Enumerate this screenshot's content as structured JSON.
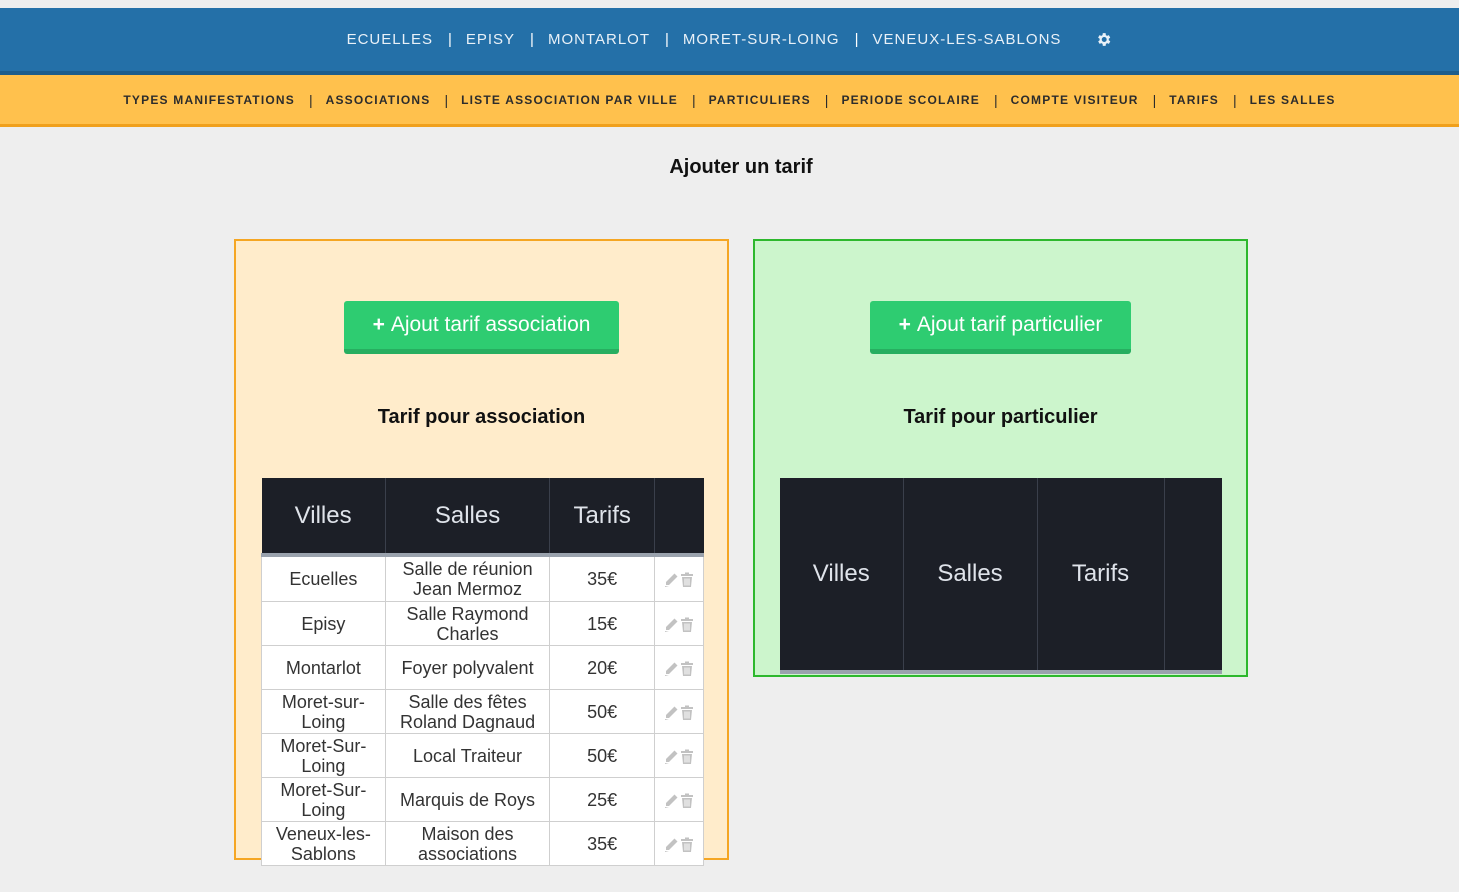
{
  "top_nav": {
    "items": [
      {
        "label": "ECUELLES"
      },
      {
        "label": "EPISY"
      },
      {
        "label": "MONTARLOT"
      },
      {
        "label": "MORET-SUR-LOING"
      },
      {
        "label": "VENEUX-LES-SABLONS"
      }
    ],
    "separator": "|",
    "settings_icon": "gear-icon"
  },
  "sub_nav": {
    "items": [
      {
        "label": "TYPES MANIFESTATIONS"
      },
      {
        "label": "ASSOCIATIONS"
      },
      {
        "label": "LISTE ASSOCIATION PAR VILLE"
      },
      {
        "label": "PARTICULIERS"
      },
      {
        "label": "PERIODE SCOLAIRE"
      },
      {
        "label": "COMPTE VISITEUR"
      },
      {
        "label": "TARIFS"
      },
      {
        "label": "LES SALLES"
      }
    ],
    "separator": "|"
  },
  "page": {
    "title": "Ajouter un tarif"
  },
  "association_panel": {
    "button_icon": "+",
    "button_label": "Ajout tarif association",
    "title": "Tarif pour association",
    "table": {
      "headers": [
        "Villes",
        "Salles",
        "Tarifs",
        ""
      ],
      "rows": [
        {
          "ville": "Ecuelles",
          "salle": "Salle de réunion Jean Mermoz",
          "tarif": "35€"
        },
        {
          "ville": "Episy",
          "salle": "Salle Raymond Charles",
          "tarif": "15€"
        },
        {
          "ville": "Montarlot",
          "salle": "Foyer polyvalent",
          "tarif": "20€"
        },
        {
          "ville": "Moret-sur-Loing",
          "salle": "Salle des fêtes Roland Dagnaud",
          "tarif": "50€"
        },
        {
          "ville": "Moret-Sur-Loing",
          "salle": "Local Traiteur",
          "tarif": "50€"
        },
        {
          "ville": "Moret-Sur-Loing",
          "salle": "Marquis de Roys",
          "tarif": "25€"
        },
        {
          "ville": "Veneux-les-Sablons",
          "salle": "Maison des associations",
          "tarif": "35€"
        }
      ],
      "row_actions": [
        "pencil-icon",
        "trash-icon"
      ]
    }
  },
  "particulier_panel": {
    "button_icon": "+",
    "button_label": "Ajout tarif particulier",
    "title": "Tarif pour particulier",
    "table": {
      "headers": [
        "Villes",
        "Salles",
        "Tarifs",
        ""
      ],
      "rows": []
    }
  },
  "colors": {
    "top_nav_bg": "#2470a8",
    "sub_nav_bg": "#ffc14d",
    "button_green": "#2ecc71",
    "assoc_panel_bg": "#ffeccb",
    "assoc_panel_border": "#f5a623",
    "part_panel_bg": "#ccf5cc",
    "part_panel_border": "#2db82d",
    "table_header_bg": "#1c1f27"
  }
}
